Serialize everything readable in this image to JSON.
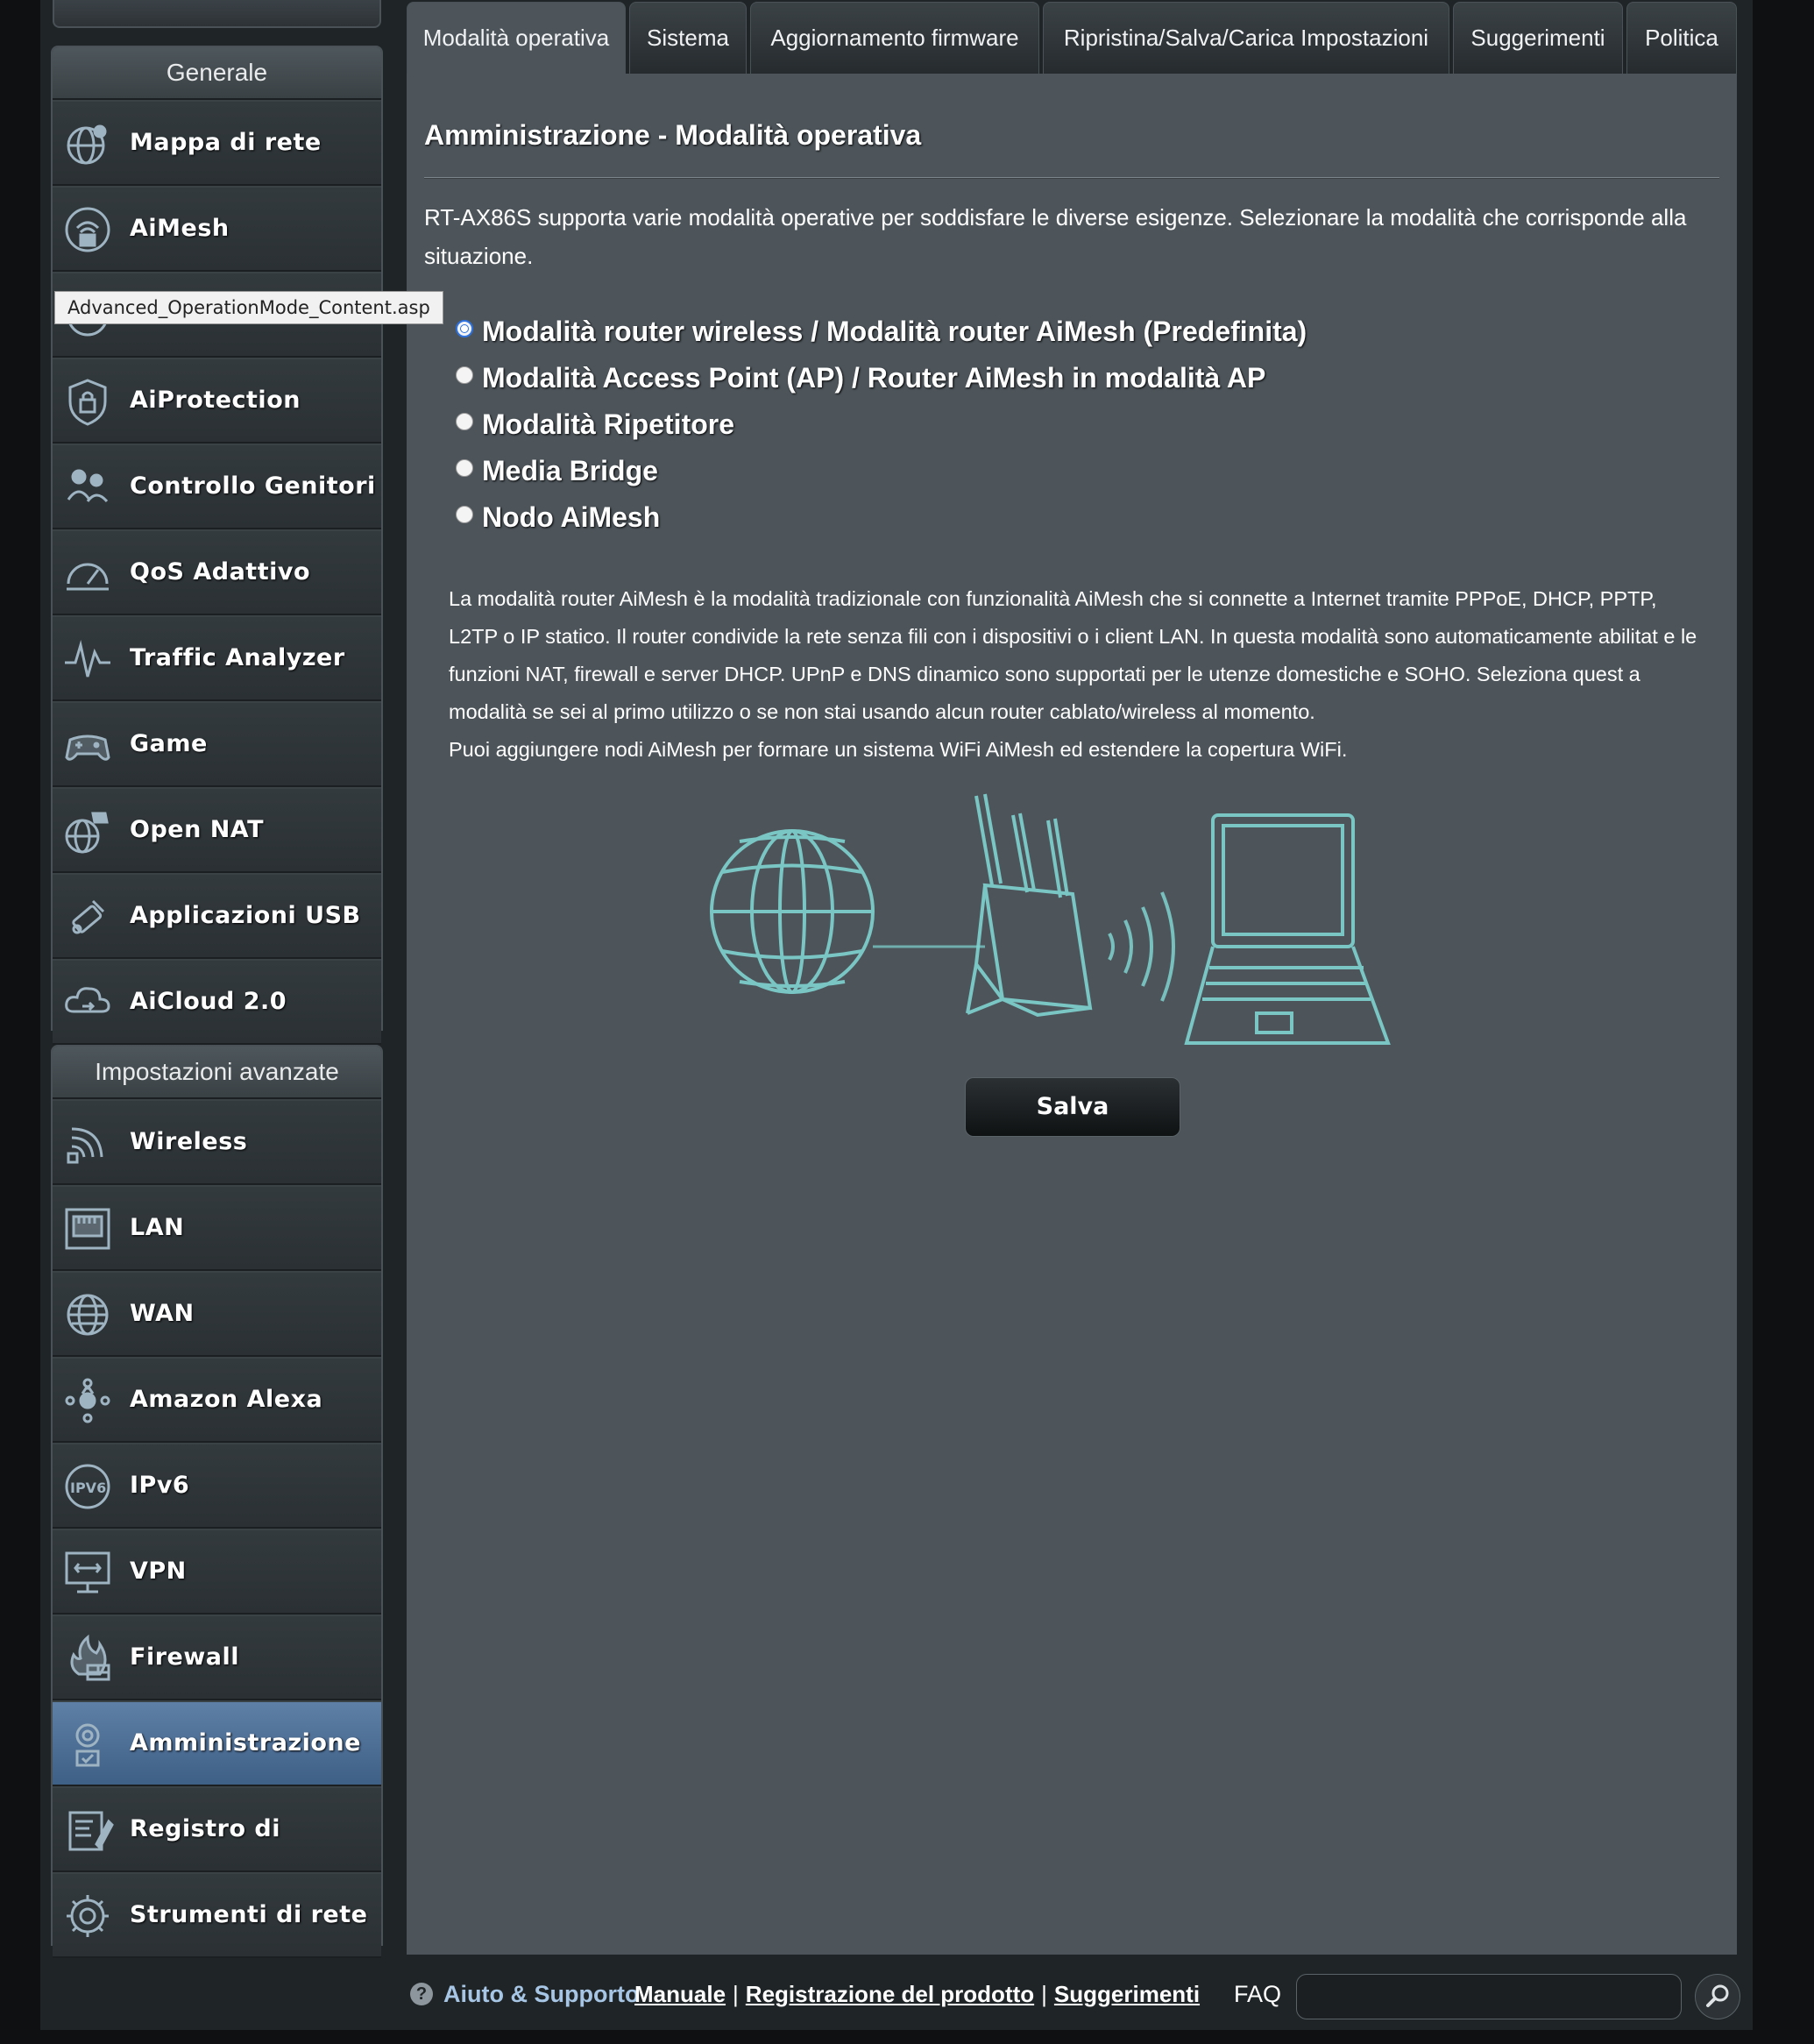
{
  "tooltip": "Advanced_OperationMode_Content.asp",
  "sidebar": {
    "general_title": "Generale",
    "general_items": [
      {
        "label": "Mappa di rete",
        "icon": "network-map-icon"
      },
      {
        "label": "AiMesh",
        "icon": "aimesh-icon"
      },
      {
        "label": "",
        "icon": "guest-network-icon"
      },
      {
        "label": "AiProtection",
        "icon": "aiprotection-icon"
      },
      {
        "label": "Controllo Genitori",
        "icon": "parental-control-icon"
      },
      {
        "label": "QoS Adattivo",
        "icon": "qos-icon"
      },
      {
        "label": "Traffic Analyzer",
        "icon": "traffic-analyzer-icon"
      },
      {
        "label": "Game",
        "icon": "game-icon"
      },
      {
        "label": "Open NAT",
        "icon": "open-nat-icon"
      },
      {
        "label": "Applicazioni USB",
        "icon": "usb-icon"
      },
      {
        "label": "AiCloud 2.0",
        "icon": "aicloud-icon"
      }
    ],
    "advanced_title": "Impostazioni avanzate",
    "advanced_items": [
      {
        "label": "Wireless",
        "icon": "wireless-icon"
      },
      {
        "label": "LAN",
        "icon": "lan-icon"
      },
      {
        "label": "WAN",
        "icon": "wan-icon"
      },
      {
        "label": "Amazon Alexa",
        "icon": "alexa-icon"
      },
      {
        "label": "IPv6",
        "icon": "ipv6-icon"
      },
      {
        "label": "VPN",
        "icon": "vpn-icon"
      },
      {
        "label": "Firewall",
        "icon": "firewall-icon"
      },
      {
        "label": "Amministrazione",
        "icon": "administration-icon"
      },
      {
        "label": "Registro di sistema",
        "icon": "system-log-icon"
      },
      {
        "label": "Strumenti di rete",
        "icon": "network-tools-icon"
      }
    ]
  },
  "tabs": [
    {
      "label": "Modalità operativa"
    },
    {
      "label": "Sistema"
    },
    {
      "label": "Aggiornamento firmware"
    },
    {
      "label": "Ripristina/Salva/Carica Impostazioni"
    },
    {
      "label": "Suggerimenti"
    },
    {
      "label": "Politica"
    }
  ],
  "main": {
    "title": "Amministrazione - Modalità operativa",
    "intro": "RT-AX86S supporta varie modalità operative per soddisfare le diverse esigenze. Selezionare la modalità che corrisponde alla situazione.",
    "modes": [
      "Modalità router wireless / Modalità router AiMesh (Predefinita)",
      "Modalità Access Point (AP) / Router AiMesh in modalità AP",
      "Modalità Ripetitore",
      "Media Bridge",
      "Nodo AiMesh"
    ],
    "selected_mode": 0,
    "description_1": "La modalità router AiMesh è la modalità tradizionale con funzionalità AiMesh che si connette a Internet tramite PPPoE, DHCP, PPTP, L2TP o IP statico. Il router condivide la rete senza fili con i dispositivi o i client LAN. In questa modalità sono automaticamente abilitat e le funzioni NAT, firewall e server DHCP. UPnP e DNS dinamico sono supportati per le utenze domestiche e SOHO. Seleziona quest a modalità se sei al primo utilizzo o se non stai usando alcun router cablato/wireless al momento.",
    "description_2": "Puoi aggiungere nodi AiMesh per formare un sistema WiFi AiMesh ed estendere la copertura WiFi.",
    "save_label": "Salva"
  },
  "footer": {
    "help_label": "Aiuto & Supporto",
    "manual": "Manuale",
    "registration": "Registrazione del prodotto",
    "suggestions": "Suggerimenti",
    "faq_label": "FAQ",
    "faq_placeholder": ""
  },
  "colors": {
    "accent_active": "#4e6f96",
    "panel": "#4d555b",
    "illustration": "#7fd3d0"
  }
}
